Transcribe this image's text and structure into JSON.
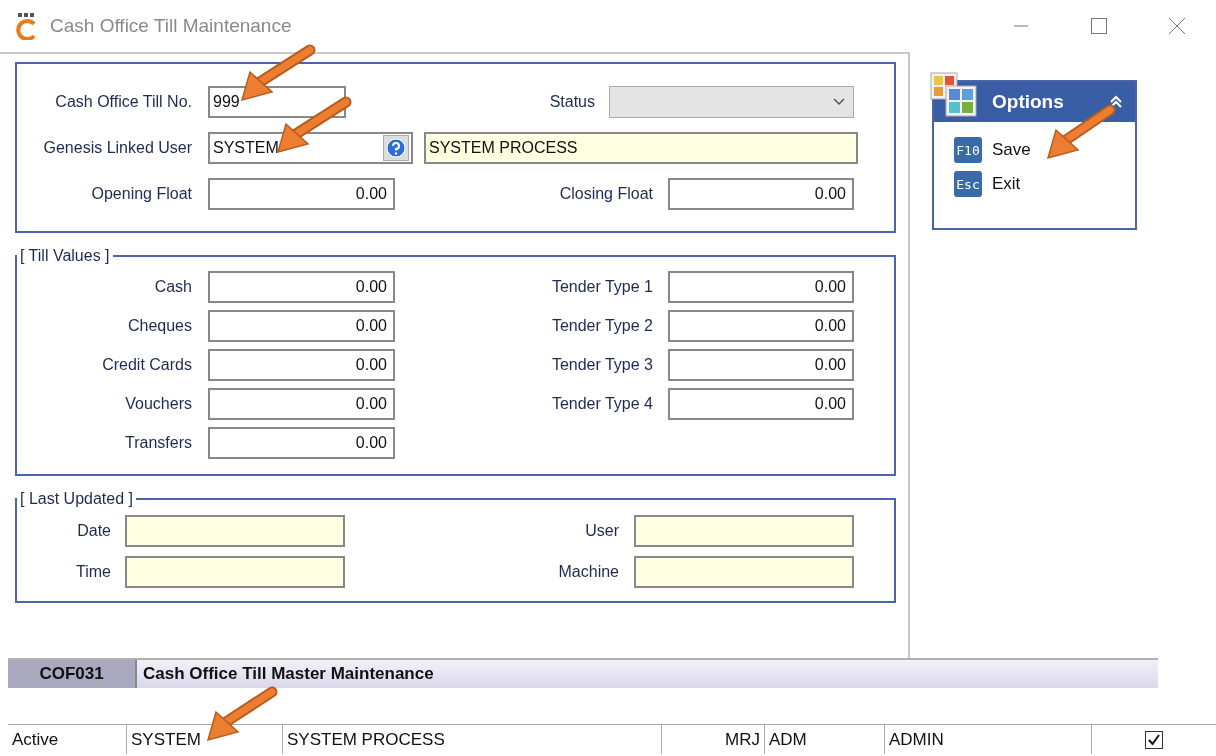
{
  "window": {
    "title": "Cash Office Till Maintenance"
  },
  "header": {
    "till_no": {
      "label": "Cash Office Till No.",
      "value": "999"
    },
    "status": {
      "label": "Status"
    },
    "linked_user": {
      "label": "Genesis Linked User",
      "value": "SYSTEM",
      "name": "SYSTEM PROCESS"
    },
    "opening_float": {
      "label": "Opening Float",
      "value": "0.00"
    },
    "closing_float": {
      "label": "Closing Float",
      "value": "0.00"
    }
  },
  "till_values": {
    "title": "[ Till Values ]",
    "left": [
      {
        "label": "Cash",
        "value": "0.00"
      },
      {
        "label": "Cheques",
        "value": "0.00"
      },
      {
        "label": "Credit Cards",
        "value": "0.00"
      },
      {
        "label": "Vouchers",
        "value": "0.00"
      },
      {
        "label": "Transfers",
        "value": "0.00"
      }
    ],
    "right": [
      {
        "label": "Tender Type 1",
        "value": "0.00"
      },
      {
        "label": "Tender Type 2",
        "value": "0.00"
      },
      {
        "label": "Tender Type 3",
        "value": "0.00"
      },
      {
        "label": "Tender Type 4",
        "value": "0.00"
      }
    ]
  },
  "last_updated": {
    "title": "[ Last Updated ]",
    "left": [
      {
        "label": "Date"
      },
      {
        "label": "Time"
      }
    ],
    "right": [
      {
        "label": "User"
      },
      {
        "label": "Machine"
      }
    ]
  },
  "options": {
    "title": "Options",
    "items": [
      {
        "key": "F10",
        "label": "Save"
      },
      {
        "key": "Esc",
        "label": "Exit"
      }
    ]
  },
  "status_bar": {
    "code": "COF031",
    "title": "Cash Office Till Master Maintenance"
  },
  "grid": {
    "rows": [
      {
        "cells": [
          "Active",
          "SYSTEM",
          "SYSTEM PROCESS",
          "MRJ",
          "ADM",
          "ADMIN"
        ],
        "checked": true
      }
    ]
  }
}
